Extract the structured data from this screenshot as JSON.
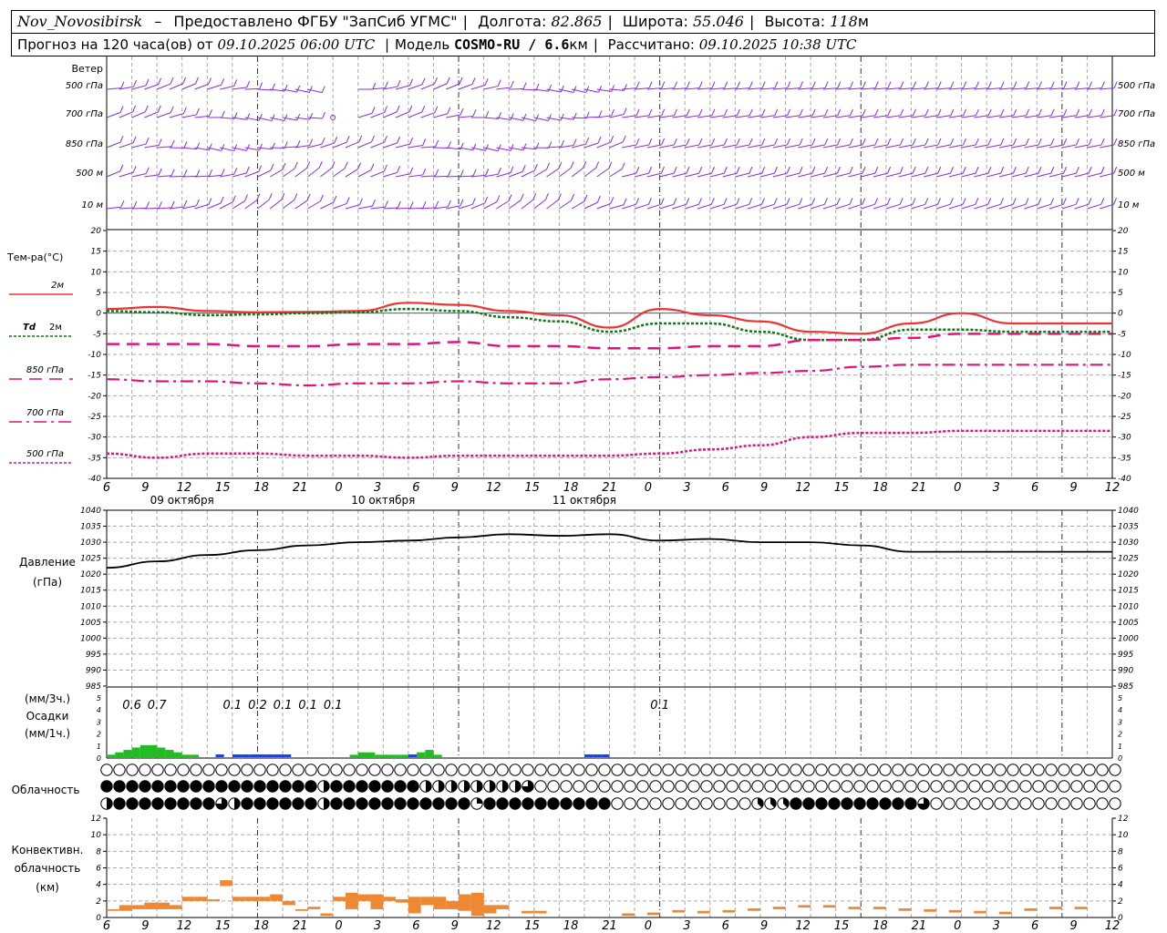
{
  "header": {
    "station": "Nov_Novosibirsk",
    "dash": "–",
    "provided": "Предоставлено ФГБУ \"ЗапСиб УГМС\"",
    "lon_label": "Долгота:",
    "lon": "82.865",
    "lat_label": "Широта:",
    "lat": "55.046",
    "alt_label": "Высота:",
    "alt": "118",
    "alt_unit": "м",
    "forecast_label": "Прогноз на 120 часа(ов) от",
    "forecast_start": "09.10.2025 06:00 UTC",
    "model_label": "Модель",
    "model": "COSMO-RU / 6.6",
    "model_unit": "км",
    "computed_label": "Рассчитано:",
    "computed": "09.10.2025 10:38 UTC"
  },
  "colors": {
    "wind": "#8a2be2",
    "t2m": "#ee3333",
    "td2m": "#117711",
    "t850": "#e0147e",
    "t700": "#e0147e",
    "t500": "#e0147e",
    "pressure": "#000000",
    "precip_rain": "#22bb22",
    "precip_snow": "#2244cc",
    "convective": "#ee8833",
    "grid": "#aaaaaa"
  },
  "time_axis": {
    "hour_labels": [
      "6",
      "9",
      "12",
      "15",
      "18",
      "21",
      "0",
      "3",
      "6",
      "9",
      "12",
      "15",
      "18",
      "21",
      "0",
      "3",
      "6",
      "9",
      "12",
      "15",
      "18",
      "21",
      "0",
      "3",
      "6",
      "9",
      "12"
    ],
    "date_labels": [
      "09 октября",
      "10 октября",
      "11 октября"
    ]
  },
  "wind": {
    "title": "Ветер",
    "levels": [
      "500 гПа",
      "700 гПа",
      "850 гПа",
      "500 м",
      "10 м"
    ]
  },
  "chart_data": [
    {
      "type": "line",
      "title": "Тем-ра(°C)",
      "x_hours": [
        0,
        6,
        12,
        18,
        24,
        30,
        36,
        42,
        48,
        54,
        60,
        66,
        72,
        78,
        84,
        90,
        96,
        102,
        108,
        114,
        120
      ],
      "ylim": [
        -40,
        20
      ],
      "yticks": [
        "20",
        "15",
        "10",
        "5",
        "0",
        "-5",
        "-10",
        "-15",
        "-20",
        "-25",
        "-30",
        "-35",
        "-40"
      ],
      "series": [
        {
          "name": "2м",
          "values": [
            1.0,
            1.5,
            0.5,
            0.2,
            0.3,
            0.5,
            2.5,
            2.0,
            0.5,
            -0.5,
            -3.5,
            1.0,
            -0.5,
            -2.0,
            -4.5,
            -5.0,
            -2.5,
            0.0,
            -2.5,
            -2.5,
            -2.5
          ]
        },
        {
          "name": "Td 2м",
          "values": [
            0.5,
            0.2,
            -0.5,
            -0.3,
            0.0,
            0.2,
            1.0,
            0.5,
            -1.0,
            -2.0,
            -4.5,
            -2.5,
            -2.5,
            -4.5,
            -6.5,
            -6.5,
            -4.0,
            -4.0,
            -4.5,
            -4.5,
            -4.5
          ]
        },
        {
          "name": "850 гПа",
          "values": [
            -7.5,
            -7.5,
            -7.5,
            -8.0,
            -8.0,
            -7.5,
            -7.5,
            -7.0,
            -8.0,
            -8.0,
            -8.5,
            -8.5,
            -8.0,
            -8.0,
            -6.5,
            -6.5,
            -6.0,
            -5.0,
            -5.0,
            -5.0,
            -5.0
          ]
        },
        {
          "name": "700 гПа",
          "values": [
            -16.0,
            -16.5,
            -16.5,
            -17.0,
            -17.5,
            -17.0,
            -17.0,
            -16.5,
            -17.0,
            -17.0,
            -16.0,
            -15.5,
            -15.0,
            -14.5,
            -14.0,
            -13.0,
            -12.5,
            -12.5,
            -12.5,
            -12.5,
            -12.5
          ]
        },
        {
          "name": "500 гПа",
          "values": [
            -34.0,
            -35.0,
            -34.0,
            -34.0,
            -34.5,
            -34.5,
            -35.0,
            -34.5,
            -34.5,
            -34.5,
            -34.5,
            -34.0,
            -33.0,
            -32.0,
            -30.0,
            -29.0,
            -29.0,
            -28.5,
            -28.5,
            -28.5,
            -28.5
          ]
        }
      ]
    },
    {
      "type": "line",
      "title": "Давление",
      "unit": "(гПа)",
      "x_hours": [
        0,
        6,
        12,
        18,
        24,
        30,
        36,
        42,
        48,
        54,
        60,
        66,
        72,
        78,
        84,
        90,
        96,
        102,
        108,
        114,
        120
      ],
      "ylim": [
        985,
        1040
      ],
      "yticks": [
        "1040",
        "1035",
        "1030",
        "1025",
        "1020",
        "1015",
        "1010",
        "1005",
        "1000",
        "995",
        "990",
        "985"
      ],
      "series": [
        {
          "name": "p",
          "values": [
            1022,
            1024,
            1026,
            1027.5,
            1029,
            1030,
            1030.5,
            1031.5,
            1032.5,
            1032,
            1032.5,
            1030.5,
            1031,
            1030,
            1030,
            1029,
            1027,
            1027,
            1027,
            1027,
            1027
          ]
        }
      ]
    },
    {
      "type": "bar",
      "title": "Осадки",
      "unit_top": "(мм/3ч.)",
      "unit_bottom": "(мм/1ч.)",
      "ylim": [
        0,
        5
      ],
      "yticks": [
        "5",
        "4",
        "3",
        "2",
        "1",
        "0"
      ],
      "totals": [
        {
          "x_hour": 3,
          "label": "0.6"
        },
        {
          "x_hour": 6,
          "label": "0.7"
        },
        {
          "x_hour": 15,
          "label": "0.1"
        },
        {
          "x_hour": 18,
          "label": "0.2"
        },
        {
          "x_hour": 21,
          "label": "0.1"
        },
        {
          "x_hour": 24,
          "label": "0.1"
        },
        {
          "x_hour": 27,
          "label": "0.1"
        },
        {
          "x_hour": 66,
          "label": "0.1"
        }
      ],
      "hourly_rain": [
        0.1,
        0.2,
        0.3,
        0.4,
        0.5,
        0.5,
        0.4,
        0.3,
        0.2,
        0.1,
        0.1,
        0,
        0,
        0,
        0,
        0,
        0,
        0,
        0,
        0,
        0,
        0,
        0,
        0,
        0,
        0,
        0,
        0,
        0,
        0.1,
        0.2,
        0.2,
        0.1,
        0.1,
        0.1,
        0.1,
        0.1,
        0.2,
        0.3,
        0.1
      ],
      "hourly_snow_hours": [
        13,
        15,
        16,
        17,
        18,
        19,
        20,
        21,
        36,
        57,
        58,
        59
      ]
    },
    {
      "type": "table",
      "title": "Облачность",
      "rows": [
        {
          "name": "high",
          "pattern": [
            [
              0,
              80,
              0
            ]
          ]
        },
        {
          "name": "middle",
          "pattern": [
            [
              0,
              17,
              8
            ],
            [
              17,
              18,
              4
            ],
            [
              18,
              25,
              8
            ],
            [
              25,
              33,
              4
            ],
            [
              33,
              34,
              6
            ],
            [
              34,
              80,
              0
            ]
          ]
        },
        {
          "name": "low",
          "pattern": [
            [
              0,
              1,
              4
            ],
            [
              1,
              9,
              8
            ],
            [
              9,
              10,
              6
            ],
            [
              10,
              11,
              4
            ],
            [
              11,
              17,
              8
            ],
            [
              17,
              18,
              4
            ],
            [
              18,
              25,
              8
            ],
            [
              25,
              29,
              8
            ],
            [
              29,
              30,
              2
            ],
            [
              30,
              40,
              8
            ],
            [
              40,
              51,
              0
            ],
            [
              51,
              54,
              3
            ],
            [
              54,
              64,
              8
            ],
            [
              64,
              65,
              6
            ],
            [
              65,
              80,
              0
            ]
          ]
        }
      ]
    },
    {
      "type": "bar",
      "title": "Конвективн. облачность",
      "unit": "(км)",
      "ylim": [
        0,
        12
      ],
      "yticks": [
        "12",
        "10",
        "8",
        "6",
        "4",
        "2",
        "0"
      ],
      "x_hours_edges": [
        0,
        1,
        2,
        3,
        4,
        5,
        6,
        7,
        8,
        9,
        10,
        11,
        12,
        13,
        14,
        15,
        16,
        17,
        18,
        19,
        20,
        21,
        22,
        23,
        24,
        25,
        26,
        27,
        28,
        29,
        30,
        31,
        32,
        33,
        34,
        35,
        36,
        37,
        38,
        39,
        40
      ],
      "bases": [
        0.8,
        0.8,
        1.0,
        1.0,
        1.0,
        1.0,
        2.0,
        2.0,
        2.0,
        3.8,
        2.0,
        2.0,
        2.0,
        2.0,
        1.5,
        0.8,
        1.0,
        0.2,
        2.0,
        1.0,
        2.0,
        1.0,
        2.0,
        1.8,
        0.5,
        1.5,
        1.0,
        1.0,
        0.8,
        0.2,
        0.5,
        1.0,
        0,
        0.5,
        0.5,
        0,
        0,
        0,
        0,
        0,
        0
      ],
      "tops": [
        1.0,
        1.5,
        1.5,
        1.8,
        1.8,
        1.5,
        2.5,
        2.5,
        2.2,
        4.5,
        2.5,
        2.5,
        2.5,
        2.8,
        2.0,
        1.0,
        1.3,
        0.5,
        2.5,
        3.0,
        2.8,
        2.8,
        2.5,
        2.2,
        2.5,
        2.5,
        2.5,
        2.0,
        2.8,
        3.0,
        1.5,
        1.5,
        0,
        0.8,
        0.8,
        0,
        0,
        0,
        0,
        0,
        0
      ]
    }
  ],
  "legend": {
    "t2m": "2м",
    "td_bold": "Td",
    "td": "2м",
    "t850": "850 гПа",
    "t700": "700 гПа",
    "t500": "500 гПа"
  }
}
